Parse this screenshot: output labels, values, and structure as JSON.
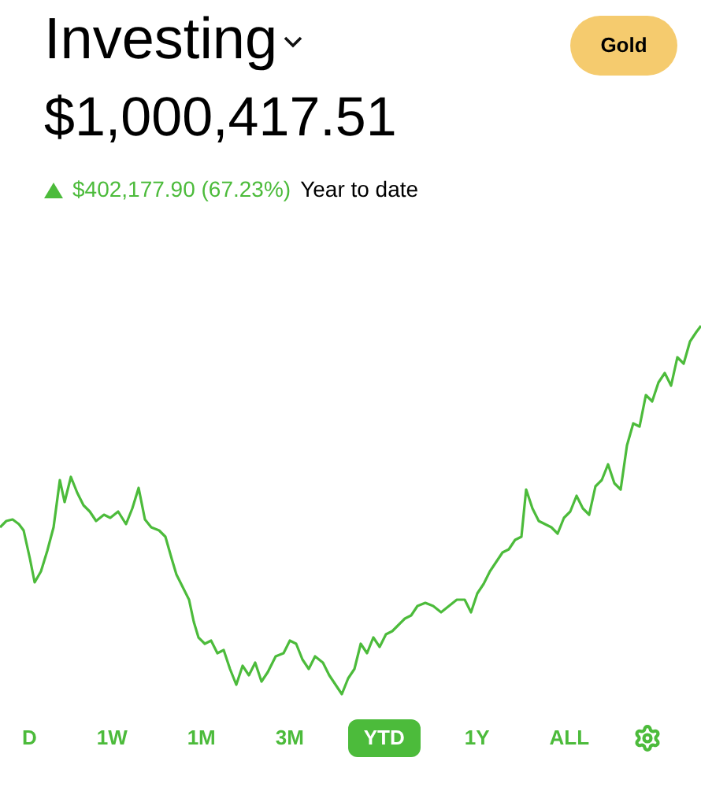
{
  "header": {
    "title": "Investing",
    "badge": "Gold"
  },
  "balance": "$1,000,417.51",
  "change": {
    "positive": true,
    "amount": "$402,177.90 (67.23%)",
    "period": "Year to date"
  },
  "ranges": [
    {
      "label": "D",
      "selected": false
    },
    {
      "label": "1W",
      "selected": false
    },
    {
      "label": "1M",
      "selected": false
    },
    {
      "label": "3M",
      "selected": false
    },
    {
      "label": "YTD",
      "selected": true
    },
    {
      "label": "1Y",
      "selected": false
    },
    {
      "label": "ALL",
      "selected": false
    }
  ]
}
